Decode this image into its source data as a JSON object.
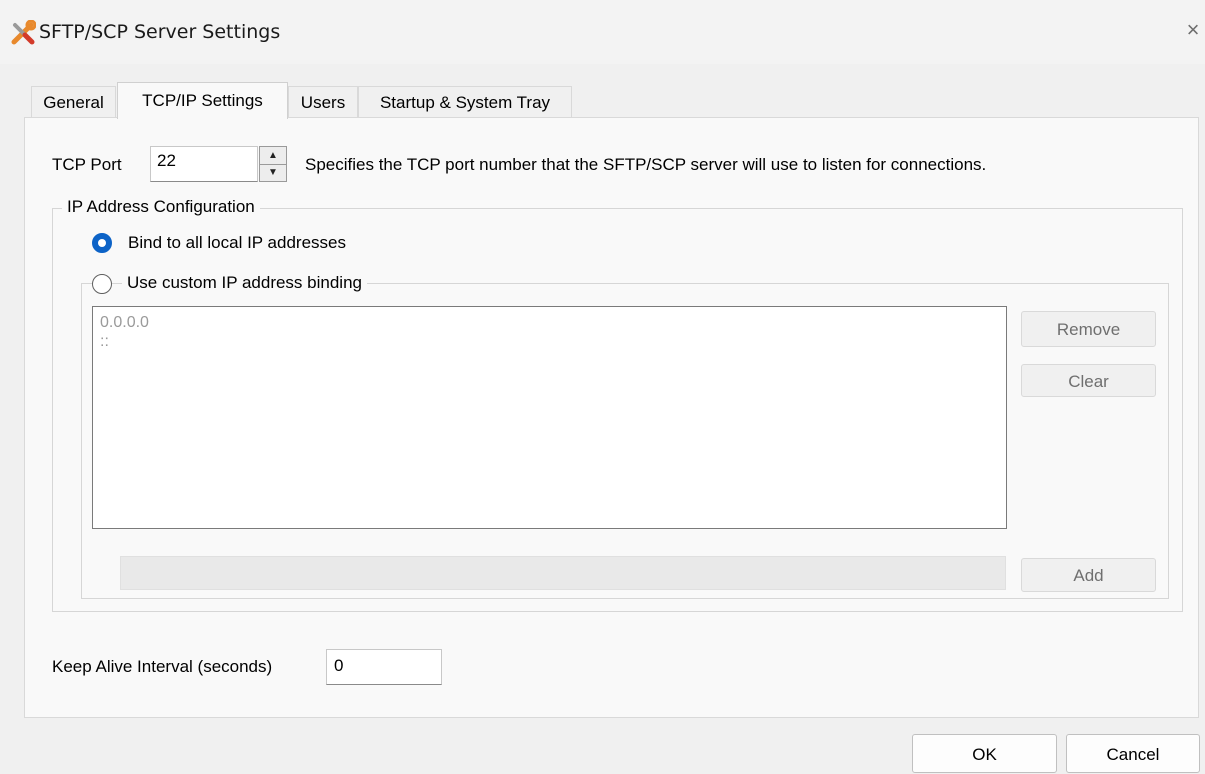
{
  "window": {
    "title": "SFTP/SCP Server Settings",
    "close_glyph": "×",
    "icon": "tools-icon"
  },
  "tabs": [
    {
      "label": "General",
      "active": false
    },
    {
      "label": "TCP/IP Settings",
      "active": true
    },
    {
      "label": "Users",
      "active": false
    },
    {
      "label": "Startup & System Tray",
      "active": false
    }
  ],
  "tcp": {
    "label": "TCP Port",
    "value": "22",
    "description": "Specifies the TCP port number that the SFTP/SCP server will use to listen for connections."
  },
  "ip_config": {
    "legend": "IP Address Configuration",
    "bind_all_label": "Bind to all local IP addresses",
    "bind_all_selected": true,
    "custom_label": "Use custom IP address binding",
    "custom_selected": false,
    "addresses": [
      "0.0.0.0",
      "::"
    ],
    "remove_label": "Remove",
    "clear_label": "Clear",
    "add_label": "Add",
    "new_address_value": ""
  },
  "keepalive": {
    "label": "Keep Alive Interval (seconds)",
    "value": "0"
  },
  "footer": {
    "ok_label": "OK",
    "cancel_label": "Cancel"
  },
  "colors": {
    "accent": "#0d63c7",
    "icon_orange": "#e8892c",
    "icon_red": "#d23a2a"
  }
}
